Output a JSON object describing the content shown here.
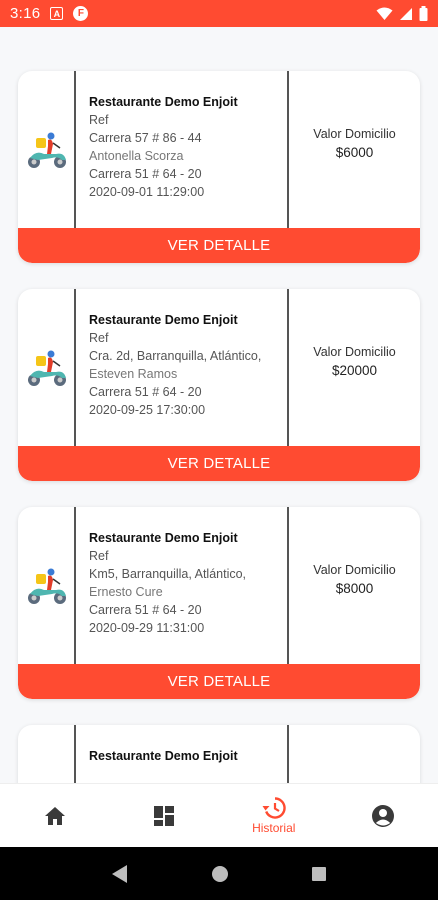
{
  "status_bar": {
    "time": "3:16",
    "notif_a": "A",
    "notif_f": "F"
  },
  "orders": [
    {
      "restaurant": "Restaurante Demo Enjoit",
      "ref": "Ref",
      "address": "Carrera 57 # 86 - 44",
      "customer": "Antonella Scorza",
      "origin": "Carrera 51 # 64 - 20",
      "datetime": "2020-09-01 11:29:00",
      "price_label": "Valor Domicilio",
      "price": "$6000",
      "button": "VER DETALLE"
    },
    {
      "restaurant": "Restaurante Demo Enjoit",
      "ref": "Ref",
      "address": "Cra. 2d, Barranquilla, Atlántico,",
      "customer": "Esteven Ramos",
      "origin": "Carrera 51 # 64 - 20",
      "datetime": "2020-09-25 17:30:00",
      "price_label": "Valor Domicilio",
      "price": "$20000",
      "button": "VER DETALLE"
    },
    {
      "restaurant": "Restaurante Demo Enjoit",
      "ref": "Ref",
      "address": "Km5, Barranquilla, Atlántico,",
      "customer": "Ernesto Cure",
      "origin": "Carrera 51 # 64 - 20",
      "datetime": "2020-09-29 11:31:00",
      "price_label": "Valor Domicilio",
      "price": "$8000",
      "button": "VER DETALLE"
    },
    {
      "restaurant": "Restaurante Demo Enjoit"
    }
  ],
  "bottom_nav": {
    "home_icon": "home-icon",
    "dashboard_icon": "dashboard-icon",
    "history_label": "Historial",
    "history_icon": "history-icon",
    "profile_icon": "account-circle-icon"
  },
  "colors": {
    "accent": "#ff4b31",
    "background": "#f7f8fa"
  }
}
